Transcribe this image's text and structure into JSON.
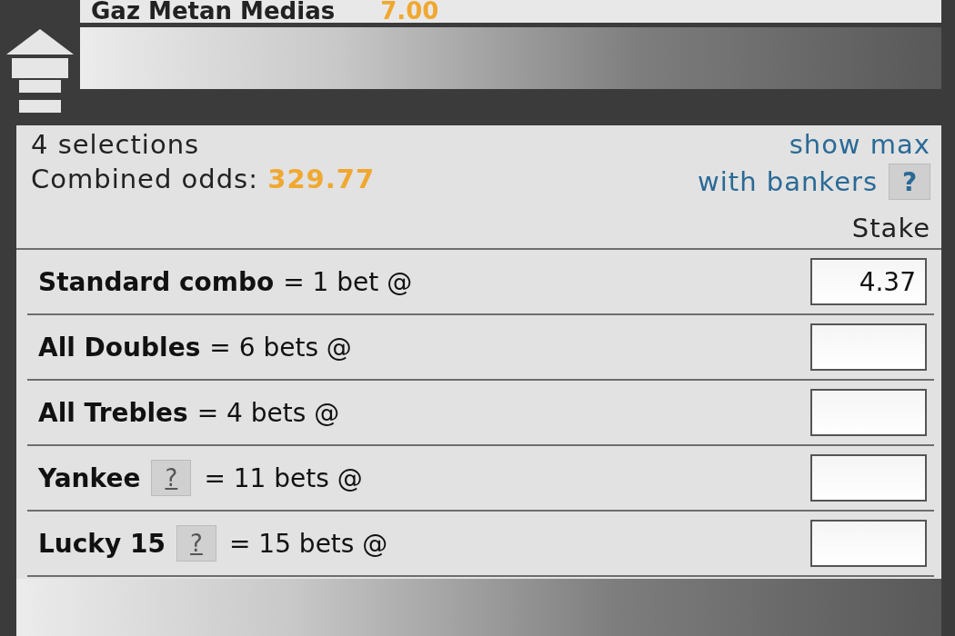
{
  "selection": {
    "name": "Gaz Metan Medias",
    "odds": "7.00"
  },
  "summary": {
    "count": "4 selections",
    "combined_label": "Combined odds:",
    "combined_odds": "329.77",
    "show_max": "show max",
    "with_bankers": "with bankers",
    "help": "?",
    "stake_label": "Stake"
  },
  "bets": [
    {
      "name": "Standard combo",
      "formula": "= 1 bet @",
      "stake": "4.37"
    },
    {
      "name": "All Doubles",
      "formula": "= 6 bets @"
    },
    {
      "name": "All Trebles",
      "formula": "= 4 bets @"
    },
    {
      "name": "Yankee",
      "help": "?",
      "formula": "= 11 bets @"
    },
    {
      "name": "Lucky 15",
      "help": "?",
      "formula": "= 15 bets @"
    }
  ]
}
